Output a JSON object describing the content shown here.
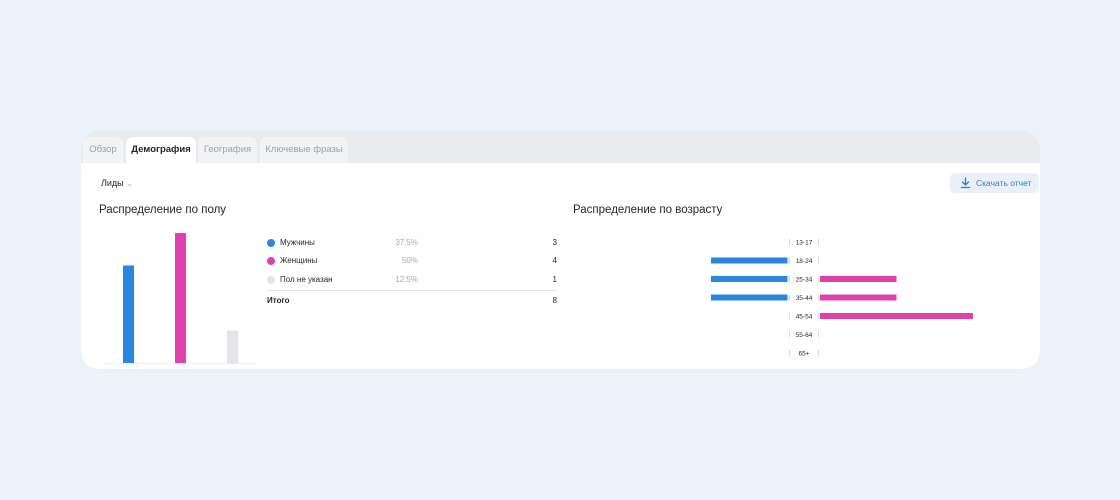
{
  "tabs": [
    {
      "label": "Обзор",
      "active": false
    },
    {
      "label": "Демография",
      "active": true
    },
    {
      "label": "География",
      "active": false
    },
    {
      "label": "Ключевые фразы",
      "active": false
    }
  ],
  "filter": {
    "label": "Лиды",
    "icon": "chevron-down-icon"
  },
  "download_button": {
    "label": "Скачать отчет",
    "icon": "download-icon"
  },
  "gender_section": {
    "title": "Распределение по полу",
    "legend": [
      {
        "name": "Мужчины",
        "percent": "37.5%",
        "count": "3",
        "color": "#2a86e0"
      },
      {
        "name": "Женщины",
        "percent": "50%",
        "count": "4",
        "color": "#e040ac"
      },
      {
        "name": "Пол не указан",
        "percent": "12.5%",
        "count": "1",
        "color": "#e3e5e8"
      }
    ],
    "total_label": "Итого",
    "total_count": "8"
  },
  "age_section": {
    "title": "Распределение по возрасту"
  },
  "colors": {
    "male": "#2a86e0",
    "female": "#e040ac",
    "unknown": "#e3e5e8",
    "accent": "#2c7ed3"
  },
  "chart_data": [
    {
      "type": "bar",
      "title": "Распределение по полу",
      "categories": [
        "Мужчины",
        "Женщины",
        "Пол не указан"
      ],
      "values": [
        3,
        4,
        1
      ],
      "colors": [
        "#2a86e0",
        "#e040ac",
        "#e3e5e8"
      ],
      "ylim": [
        0,
        4
      ]
    },
    {
      "type": "bar",
      "title": "Распределение по возрасту",
      "orientation": "horizontal-diverging",
      "categories": [
        "13-17",
        "18-24",
        "25-34",
        "35-44",
        "45-54",
        "55-64",
        "65+"
      ],
      "series": [
        {
          "values": [
            0,
            1,
            1,
            1,
            0,
            0,
            0
          ],
          "color": "#2a86e0"
        },
        {
          "values": [
            0,
            0,
            1,
            1,
            2,
            0,
            0
          ],
          "color": "#e040ac"
        }
      ],
      "xlim": [
        0,
        2
      ]
    }
  ]
}
